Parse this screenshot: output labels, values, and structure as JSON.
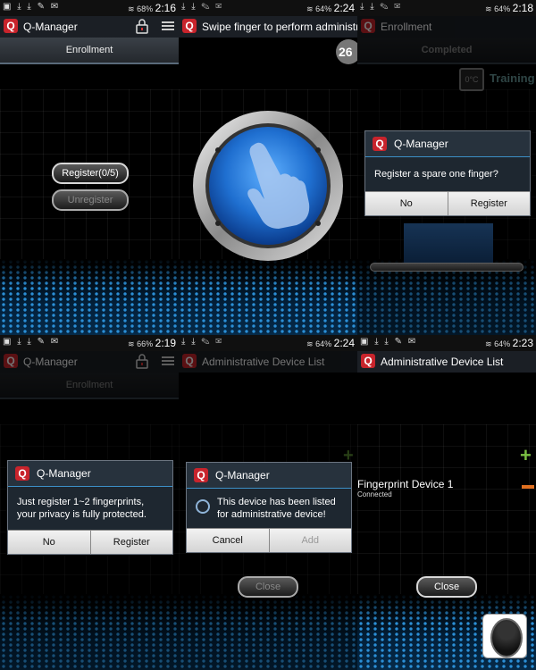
{
  "panels": [
    {
      "status": {
        "battery": "68%",
        "time": "2:16"
      },
      "app_title": "Q-Manager",
      "tab": "Enrollment",
      "register_button": "Register(0/5)",
      "unregister_button": "Unregister"
    },
    {
      "status": {
        "battery": "64%",
        "time": "2:24"
      },
      "app_title": "Swipe finger to perform administr...",
      "countdown": "26"
    },
    {
      "status": {
        "battery": "64%",
        "time": "2:18"
      },
      "app_title": "Enrollment",
      "tab": "Completed",
      "training_label": "Training",
      "dialog": {
        "title": "Q-Manager",
        "message": "Register a spare one finger?",
        "no": "No",
        "yes": "Register"
      }
    },
    {
      "status": {
        "battery": "66%",
        "time": "2:19"
      },
      "app_title": "Q-Manager",
      "tab": "Enrollment",
      "dialog": {
        "title": "Q-Manager",
        "message": "Just register 1~2 fingerprints, your privacy is fully protected.",
        "no": "No",
        "yes": "Register"
      }
    },
    {
      "status": {
        "battery": "64%",
        "time": "2:24"
      },
      "app_title": "Administrative Device List",
      "close_button": "Close",
      "dialog": {
        "title": "Q-Manager",
        "message": "This device has been listed for administrative device!",
        "cancel": "Cancel",
        "add": "Add"
      }
    },
    {
      "status": {
        "battery": "64%",
        "time": "2:23"
      },
      "app_title": "Administrative Device List",
      "device_name": "Fingerprint Device 1",
      "device_status": "Connected",
      "close_button": "Close"
    }
  ],
  "colors": {
    "brand_red": "#c8242c",
    "accent_blue": "#2b8fd6",
    "add_green": "#7bc043",
    "remove_orange": "#e07020"
  }
}
